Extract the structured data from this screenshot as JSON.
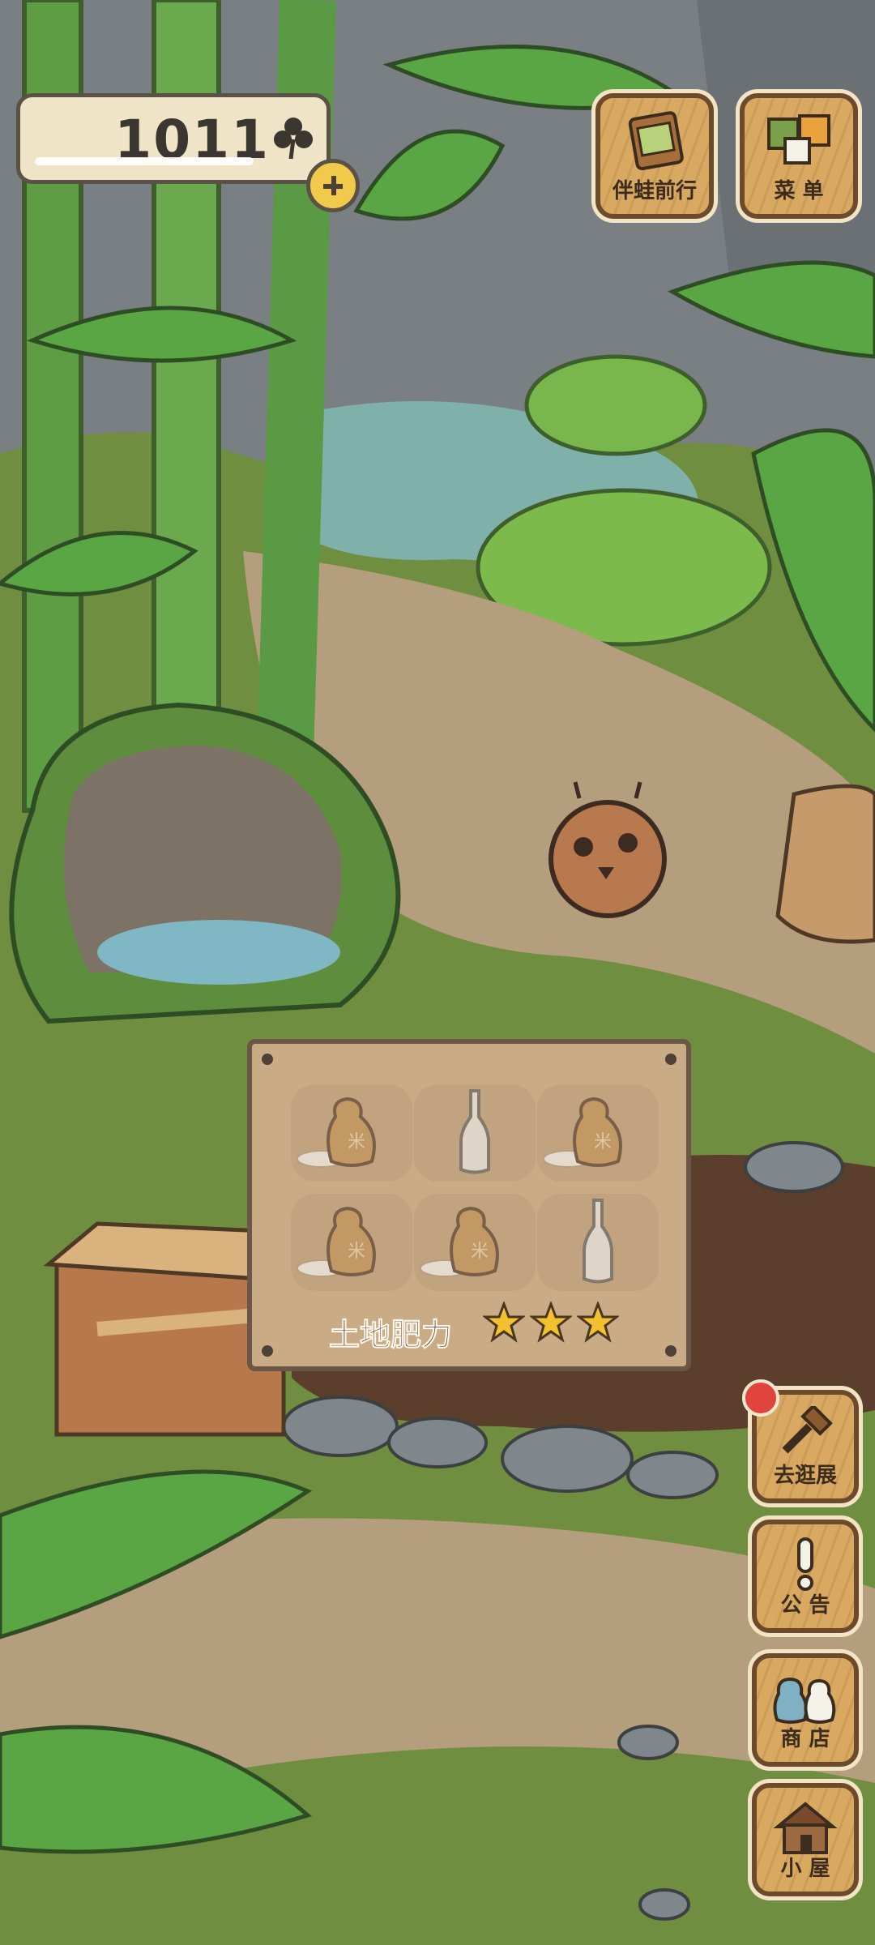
{
  "hud": {
    "clover_count": "1011"
  },
  "top_buttons": {
    "travel_label": "伴蛙前行",
    "menu_label": "菜 单"
  },
  "side_buttons": {
    "exhibit_label": "去逛展",
    "notice_label": "公 告",
    "shop_label": "商 店",
    "house_label": "小 屋"
  },
  "garden": {
    "fertility_label": "土地肥力",
    "fertility_stars": 3,
    "slots": [
      {
        "item": "rice-bag",
        "mark": "米"
      },
      {
        "item": "glass-bottle"
      },
      {
        "item": "rice-bag",
        "mark": "米"
      },
      {
        "item": "rice-bag",
        "mark": "米"
      },
      {
        "item": "rice-bag",
        "mark": "米"
      },
      {
        "item": "glass-bottle"
      }
    ]
  },
  "colors": {
    "grass": "#6f8e3f",
    "path": "#b59e7d",
    "wood": "#d9a962",
    "star": "#f3c12f",
    "soil": "#5b3e2b"
  }
}
